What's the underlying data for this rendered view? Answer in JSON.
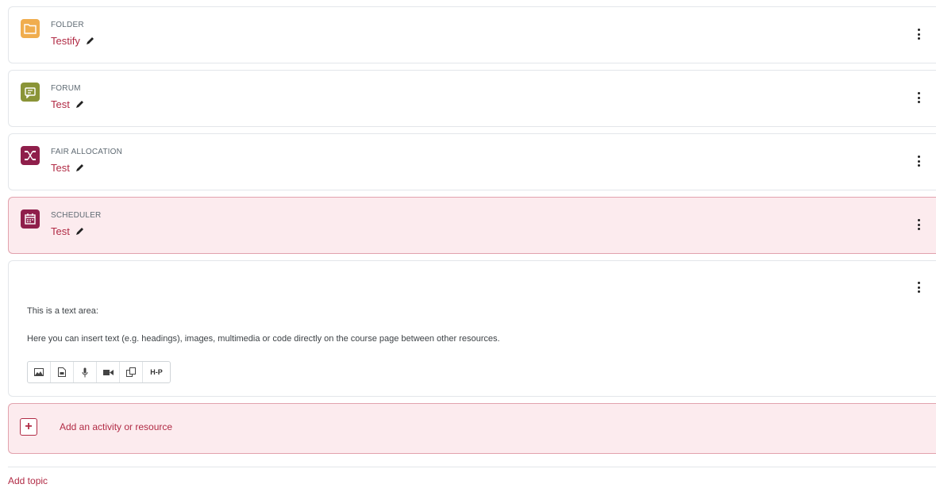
{
  "activities": [
    {
      "type": "FOLDER",
      "name": "Testify",
      "icon": "folder-icon",
      "color": "#f0ad4e"
    },
    {
      "type": "FORUM",
      "name": "Test",
      "icon": "forum-icon",
      "color": "#8a9437"
    },
    {
      "type": "FAIR ALLOCATION",
      "name": "Test",
      "icon": "fair-allocation-icon",
      "color": "#8f1f4b"
    },
    {
      "type": "SCHEDULER",
      "name": "Test",
      "icon": "scheduler-icon",
      "color": "#8f1f4b"
    }
  ],
  "text_area": {
    "line1": "This is a text area:",
    "line2": "Here you can insert text (e.g. headings), images, multimedia or code directly on the course page between other resources.",
    "toolbar": [
      "image-icon",
      "file-icon",
      "microphone-icon",
      "video-camera-icon",
      "copy-icon",
      "h5p-icon"
    ],
    "h5p_label": "H-P"
  },
  "add_activity": {
    "label": "Add an activity or resource",
    "icon": "plus-icon"
  },
  "add_topic": "Add topic",
  "colors": {
    "accent": "#b12b45",
    "highlight_bg": "#fcebee"
  }
}
